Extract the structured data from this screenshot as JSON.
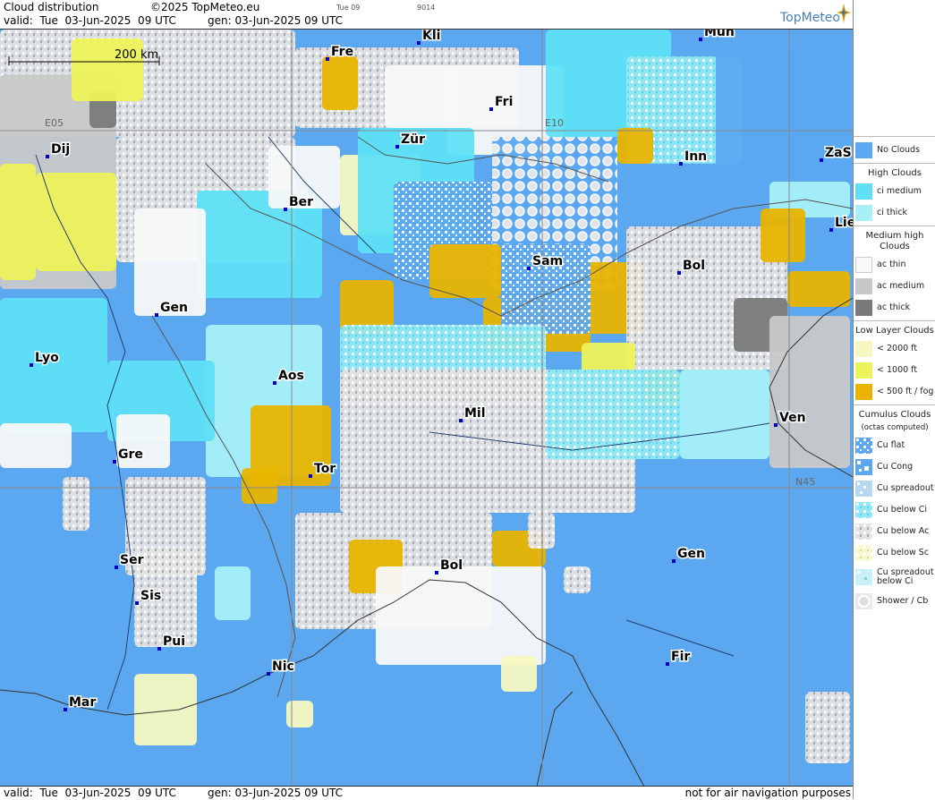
{
  "header": {
    "title": "Cloud distribution",
    "copyright": "©2025 TopMeteo.eu",
    "small_time": "Tue 09",
    "small_code": "9014",
    "valid_line": "valid:  Tue  03-Jun-2025  09 UTC",
    "gen_line": "gen: 03-Jun-2025 09 UTC",
    "brand": "TopMeteo"
  },
  "footer": {
    "valid_line": "valid:  Tue  03-Jun-2025  09 UTC",
    "gen_line": "gen: 03-Jun-2025 09 UTC",
    "notice": "not for air navigation purposes"
  },
  "map": {
    "scale_label": "200 km",
    "grid_labels": {
      "e05": "E05",
      "e10": "E10",
      "n45": "N45"
    },
    "cities": [
      "Fre",
      "Kli",
      "Mun",
      "Fri",
      "Dij",
      "Zür",
      "E10",
      "Inn",
      "ZaS",
      "Ber",
      "Lie",
      "Sam",
      "Bol",
      "Gen",
      "Lyo",
      "Aos",
      "Mil",
      "Ven",
      "Gre",
      "Tor",
      "N45",
      "Ser",
      "Gen",
      "Bol",
      "Sis",
      "Pui",
      "Nic",
      "Fir",
      "Mar"
    ]
  },
  "legend": {
    "no_clouds": "No Clouds",
    "high_clouds": "High Clouds",
    "ci_medium": "ci medium",
    "ci_thick": "ci thick",
    "medium_high": "Medium high Clouds",
    "ac_thin": "ac thin",
    "ac_medium": "ac medium",
    "ac_thick": "ac thick",
    "low_layer": "Low Layer Clouds",
    "low_2000": "< 2000 ft",
    "low_1000": "< 1000 ft",
    "low_500": "< 500 ft / fog",
    "cumulus": "Cumulus Clouds",
    "octas": "(octas computed)",
    "cu_flat": "Cu flat",
    "cu_cong": "Cu Cong",
    "cu_spreadout": "Cu spreadout",
    "cu_below_ci": "Cu below Ci",
    "cu_below_ac": "Cu below Ac",
    "cu_below_sc": "Cu below Sc",
    "cu_spread_below_ci": "Cu spreadout below Ci",
    "shower_cb": "Shower / Cb"
  },
  "colors": {
    "no_clouds": "#5ba8f0",
    "ci_medium": "#5fe0f5",
    "ci_thick": "#a8f0f8",
    "ac_thin": "#f8f8f8",
    "ac_medium": "#c8c8c8",
    "ac_thick": "#7a7a7a",
    "low_2000": "#f6f7c0",
    "low_1000": "#eef25a",
    "low_500": "#e8b400"
  }
}
